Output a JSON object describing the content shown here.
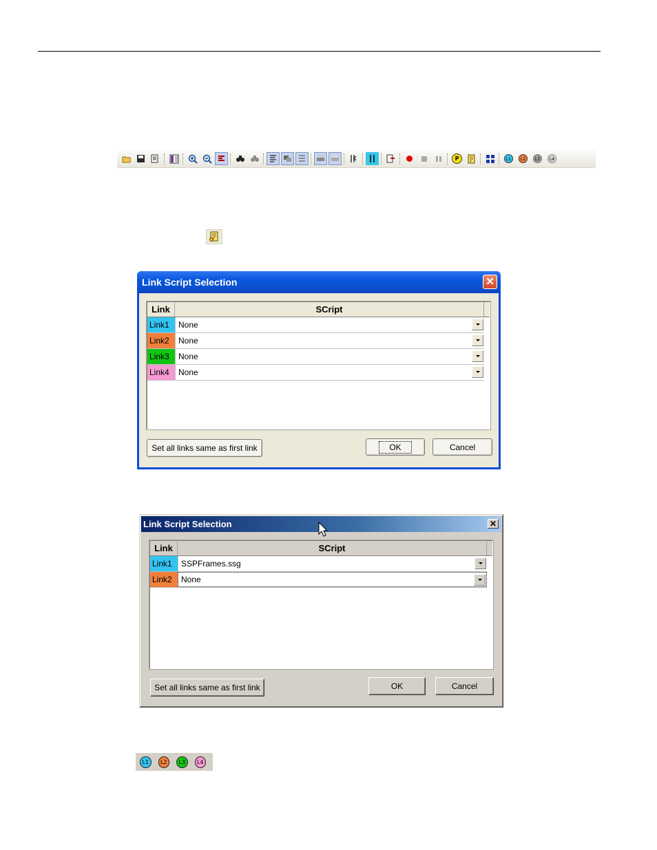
{
  "colors": {
    "link1": "#33c3f0",
    "link2": "#f07f3c",
    "link3": "#12c412",
    "link4": "#f59ad2",
    "xp_title": "#0855dd",
    "classic_title": "#0a246a",
    "record": "#e60000"
  },
  "toolbar": {
    "icons": [
      "open-folder-icon",
      "save-icon",
      "edit-icon",
      "columns-icon",
      "zoom-in-icon",
      "zoom-out-icon",
      "filter-icon",
      "find-icon",
      "find-next-icon",
      "link-icon",
      "link-pressed-icon",
      "link-3-icon",
      "print-icon",
      "print-preview-icon",
      "tools-icon",
      "split-icon",
      "export-icon",
      "record-icon",
      "stop-icon",
      "pause-icon",
      "p-icon",
      "script-select-icon",
      "grid-icon",
      "l1-icon",
      "l2-icon",
      "l3-icon",
      "l4-icon"
    ],
    "link_labels": [
      "L1",
      "L2",
      "L3",
      "L4"
    ],
    "p_label": "P"
  },
  "dialog1": {
    "title": "Link Script Selection",
    "columns": {
      "link": "Link",
      "script": "SCript"
    },
    "rows": [
      {
        "link": "Link1",
        "script": "None"
      },
      {
        "link": "Link2",
        "script": "None"
      },
      {
        "link": "Link3",
        "script": "None"
      },
      {
        "link": "Link4",
        "script": "None"
      }
    ],
    "set_all_label": "Set all links same as first link",
    "ok_label": "OK",
    "cancel_label": "Cancel"
  },
  "dialog2": {
    "title": "Link Script Selection",
    "columns": {
      "link": "Link",
      "script": "SCript"
    },
    "rows": [
      {
        "link": "Link1",
        "script": "SSPFrames.ssg"
      },
      {
        "link": "Link2",
        "script": "None"
      }
    ],
    "set_all_label": "Set all links same as first link",
    "ok_label": "OK",
    "cancel_label": "Cancel",
    "close_glyph": "✕"
  },
  "link_strip": {
    "labels": [
      "L1",
      "L2",
      "L3",
      "L4"
    ]
  }
}
